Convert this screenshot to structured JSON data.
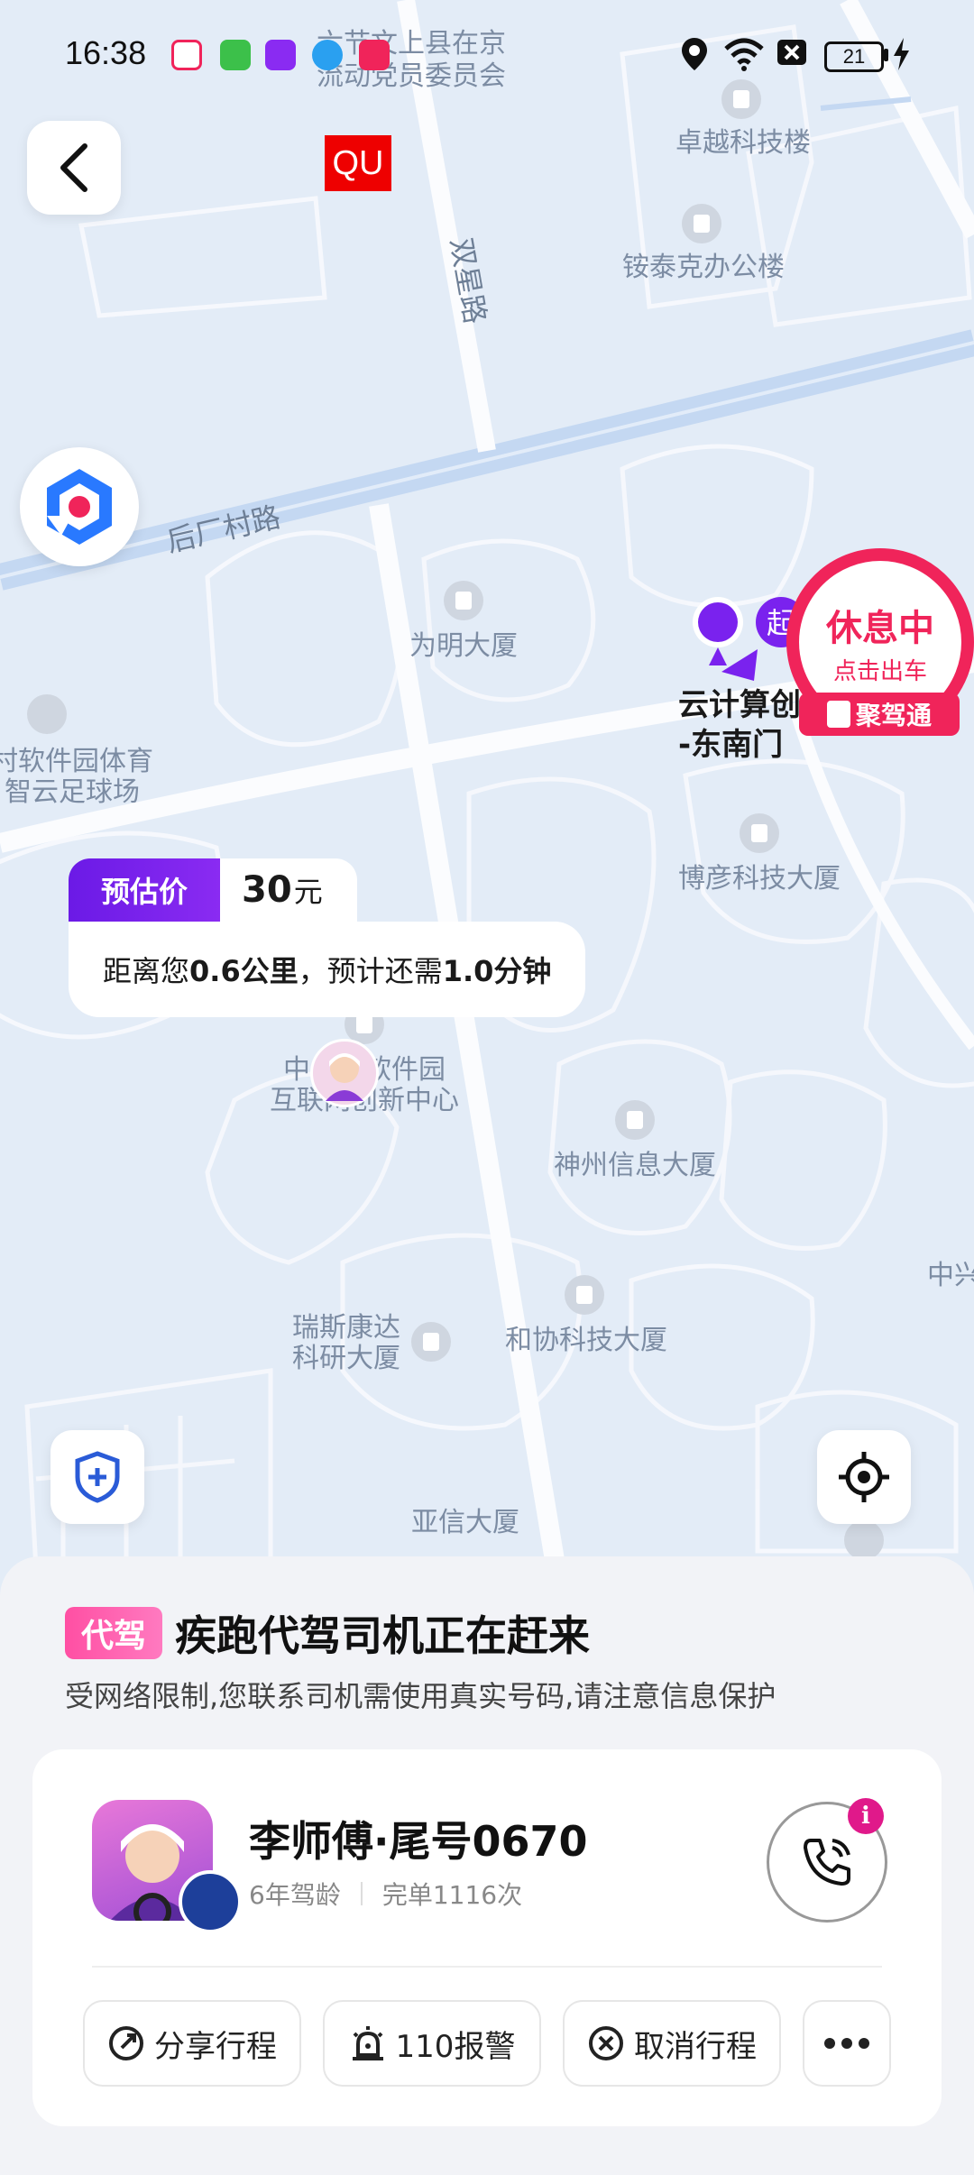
{
  "status_bar": {
    "time": "16:38",
    "battery": "21",
    "icons": [
      "location-icon",
      "wifi-icon",
      "no-sim-icon",
      "battery-icon",
      "charging-icon"
    ]
  },
  "map": {
    "labels": {
      "top_commission_1": "六节文上县在京",
      "top_commission_2": "流动党员委员会",
      "zhuoyue": "卓越科技楼",
      "antaike": "铵泰克办公楼",
      "shuangxing": "双星路",
      "houchang": "后厂村路",
      "weiming": "为明大厦",
      "stadium_1": "村软件园体育",
      "stadium_2": "智云足球场",
      "boyan": "博彦科技大厦",
      "zhongguan_1": "中关村软件园",
      "zhongguan_2": "互联网创新中心",
      "shenzhou": "神州信息大厦",
      "zhongxing": "中兴",
      "ruisi_1": "瑞斯康达",
      "ruisi_2": "科研大厦",
      "hexie": "和协科技大厦",
      "yaxin": "亚信大厦",
      "start_marker": "起"
    },
    "qu_badge": "QU",
    "destination_line1": "云计算创",
    "destination_line2": "-东南门"
  },
  "rest_badge": {
    "title": "休息中",
    "subtitle": "点击出车",
    "brand": "聚驾通"
  },
  "price_card": {
    "tag": "预估价",
    "value": "30",
    "unit": "元",
    "text_a": "距离您",
    "distance": "0.6公里",
    "text_b": "，预计还需",
    "eta": "1.0分钟"
  },
  "sheet": {
    "tag": "代驾",
    "title": "疾跑代驾司机正在赶来",
    "note": "受网络限制,您联系司机需使用真实号码,请注意信息保护"
  },
  "driver": {
    "name": "李师傅·尾号0670",
    "years": "6年驾龄",
    "orders": "完单1116次",
    "call_badge": "i"
  },
  "actions": {
    "share": "分享行程",
    "police": "110报警",
    "cancel": "取消行程"
  },
  "colors": {
    "accent_purple": "#7a22ee",
    "accent_pink": "#f0245a",
    "map_bg": "#e3ecf7"
  }
}
